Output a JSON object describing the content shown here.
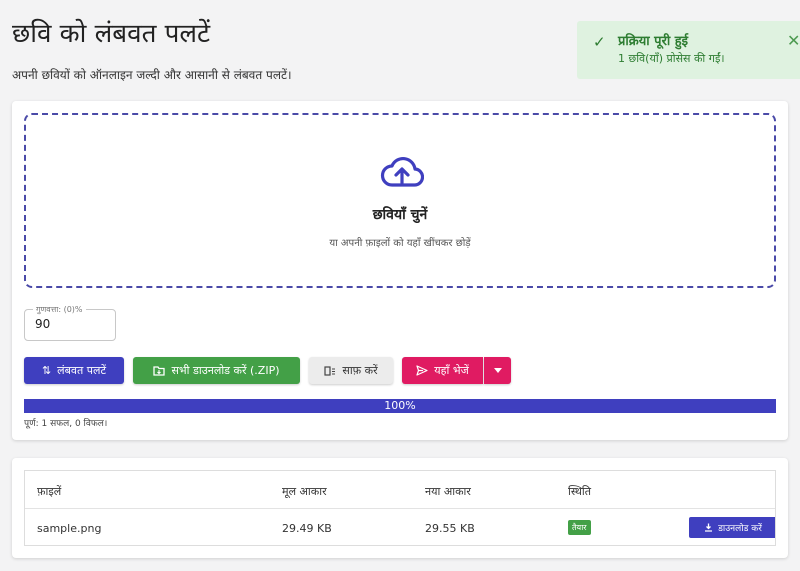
{
  "header": {
    "title": "छवि को लंबवत पलटें",
    "subtitle": "अपनी छवियों को ऑनलाइन जल्दी और आसानी से लंबवत पलटें।"
  },
  "toast": {
    "title": "प्रक्रिया पूरी हुई",
    "message": "1 छवि(याँ) प्रोसेस की गईं।",
    "icon": "check-icon",
    "close_icon": "close-icon"
  },
  "dropzone": {
    "title": "छवियाँ चुनें",
    "hint": "या अपनी फ़ाइलों को यहाँ खींचकर छोड़ें",
    "icon": "cloud-upload-icon"
  },
  "quality": {
    "label": "गुणवत्ता: (0)%",
    "value": "90"
  },
  "buttons": {
    "rotate": "लंबवत पलटें",
    "download_zip": "सभी डाउनलोड करें (.ZIP)",
    "clear": "साफ़ करें",
    "send": "यहाँ भेजें"
  },
  "progress": {
    "percent": 100,
    "label": "100%",
    "summary": "पूर्ण: 1 सफल, 0 विफल।"
  },
  "table": {
    "headers": [
      "फ़ाइलें",
      "मूल आकार",
      "नया आकार",
      "स्थिति"
    ],
    "rows": [
      {
        "file": "sample.png",
        "original_size": "29.49 KB",
        "new_size": "29.55 KB",
        "status": "तैयार",
        "download_label": "डाउनलोड करें"
      }
    ]
  },
  "colors": {
    "primary": "#3f3fbf",
    "success": "#43a047",
    "pink": "#e01b62",
    "toast_bg": "#dff2e0"
  }
}
